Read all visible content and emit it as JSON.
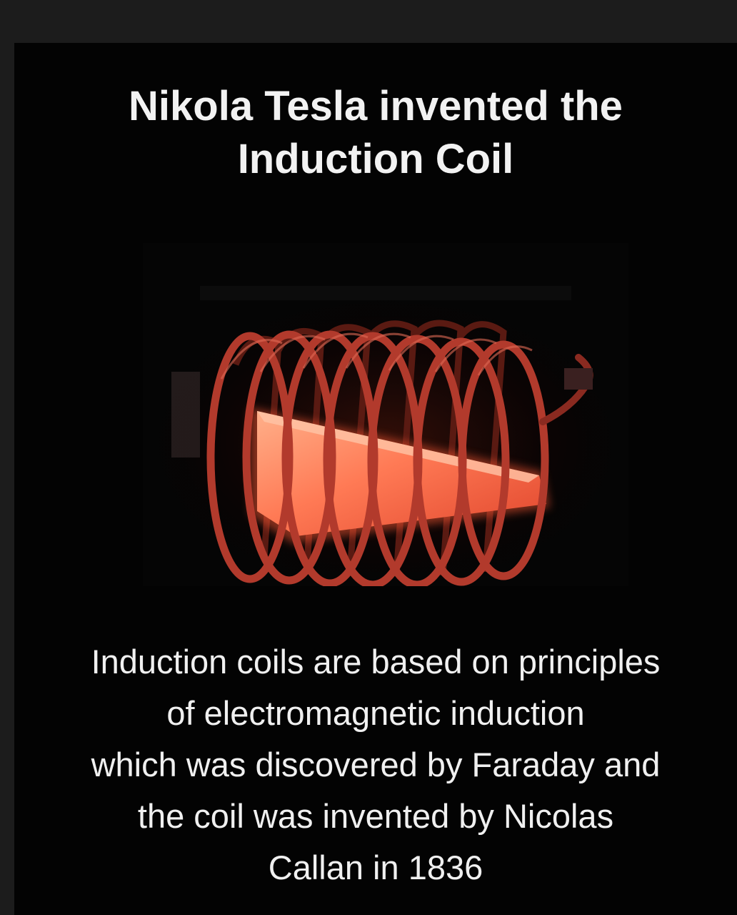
{
  "colors": {
    "page_background": "#1c1c1c",
    "card_background": "#030303",
    "text": "#f0f0f0",
    "coil": "#b23a2c",
    "glow": "#ff7a55"
  },
  "title": {
    "line1": "Nikola Tesla invented the",
    "line2": "Induction Coil"
  },
  "illustration": {
    "icon": "glowing-induction-coil-photo"
  },
  "caption": {
    "lines": [
      "Induction coils are based on principles",
      "of electromagnetic induction",
      "which was discovered by Faraday and",
      "the coil was invented by Nicolas",
      "Callan in 1836"
    ]
  }
}
